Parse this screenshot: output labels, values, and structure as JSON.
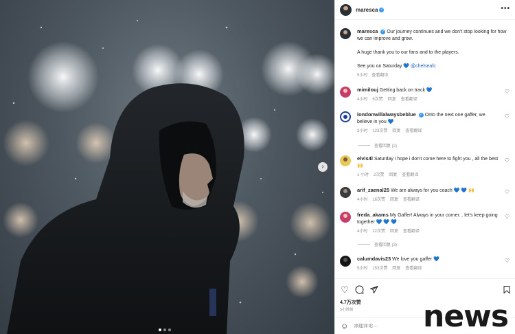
{
  "post": {
    "username": "maresca",
    "caption_line1": "Our journey continues and we don't stop looking for how we can improve and grow.",
    "caption_line2": "A huge thank you to our fans and to the players.",
    "caption_line3_prefix": "See you on Saturday",
    "caption_heart": "💙",
    "caption_mention": "@chelseafc",
    "caption_time": "5小时",
    "caption_translate": "查看翻译"
  },
  "comments": [
    {
      "username": "mimilouj",
      "text": "Getting back on track 💙",
      "time": "4小时",
      "likes": "6次赞",
      "reply": "回复",
      "translate": "查看翻译",
      "verified": false
    },
    {
      "username": "londonwillalwaysbeblue",
      "text": "Onto the next one gaffer, we believe in you 💙",
      "time": "3小时",
      "likes": "123次赞",
      "reply": "回复",
      "translate": "查看翻译",
      "verified": true,
      "replies": "查看回复 (2)"
    },
    {
      "username": "elvis4l",
      "text": "Saturday i hope i don't come here to fight you , all the best🙌",
      "time": "1 小时",
      "likes": "2次赞",
      "reply": "回复",
      "translate": "查看翻译",
      "verified": false
    },
    {
      "username": "arif_zaenal25",
      "text": "We are always for you coach 💙 💙 🙌",
      "time": "4小时",
      "likes": "16次赞",
      "reply": "回复",
      "translate": "查看翻译",
      "verified": false
    },
    {
      "username": "freda_akams",
      "text": "My Gaffer! Always in your corner... let's keep going together 💙 💙 💙",
      "time": "4小时",
      "likes": "22次赞",
      "reply": "回复",
      "translate": "查看翻译",
      "verified": false,
      "replies": "查看回复 (3)"
    },
    {
      "username": "calumdavis23",
      "text": "We love you gaffer 💙",
      "time": "5小时",
      "likes": "153次赞",
      "reply": "回复",
      "translate": "查看翻译",
      "verified": false
    }
  ],
  "footer": {
    "likes": "4.7万次赞",
    "time": "5小时前",
    "comment_placeholder": "添加评论..."
  },
  "icons": {
    "like": "heart-icon",
    "comment": "comment-icon",
    "share": "paper-plane-icon",
    "save": "bookmark-icon",
    "emoji": "smiley-icon",
    "more": "ellipsis-icon",
    "next": "chevron-right-icon"
  },
  "colors": {
    "verified": "#3897f0",
    "link": "#1d63b7"
  },
  "watermark": "news"
}
